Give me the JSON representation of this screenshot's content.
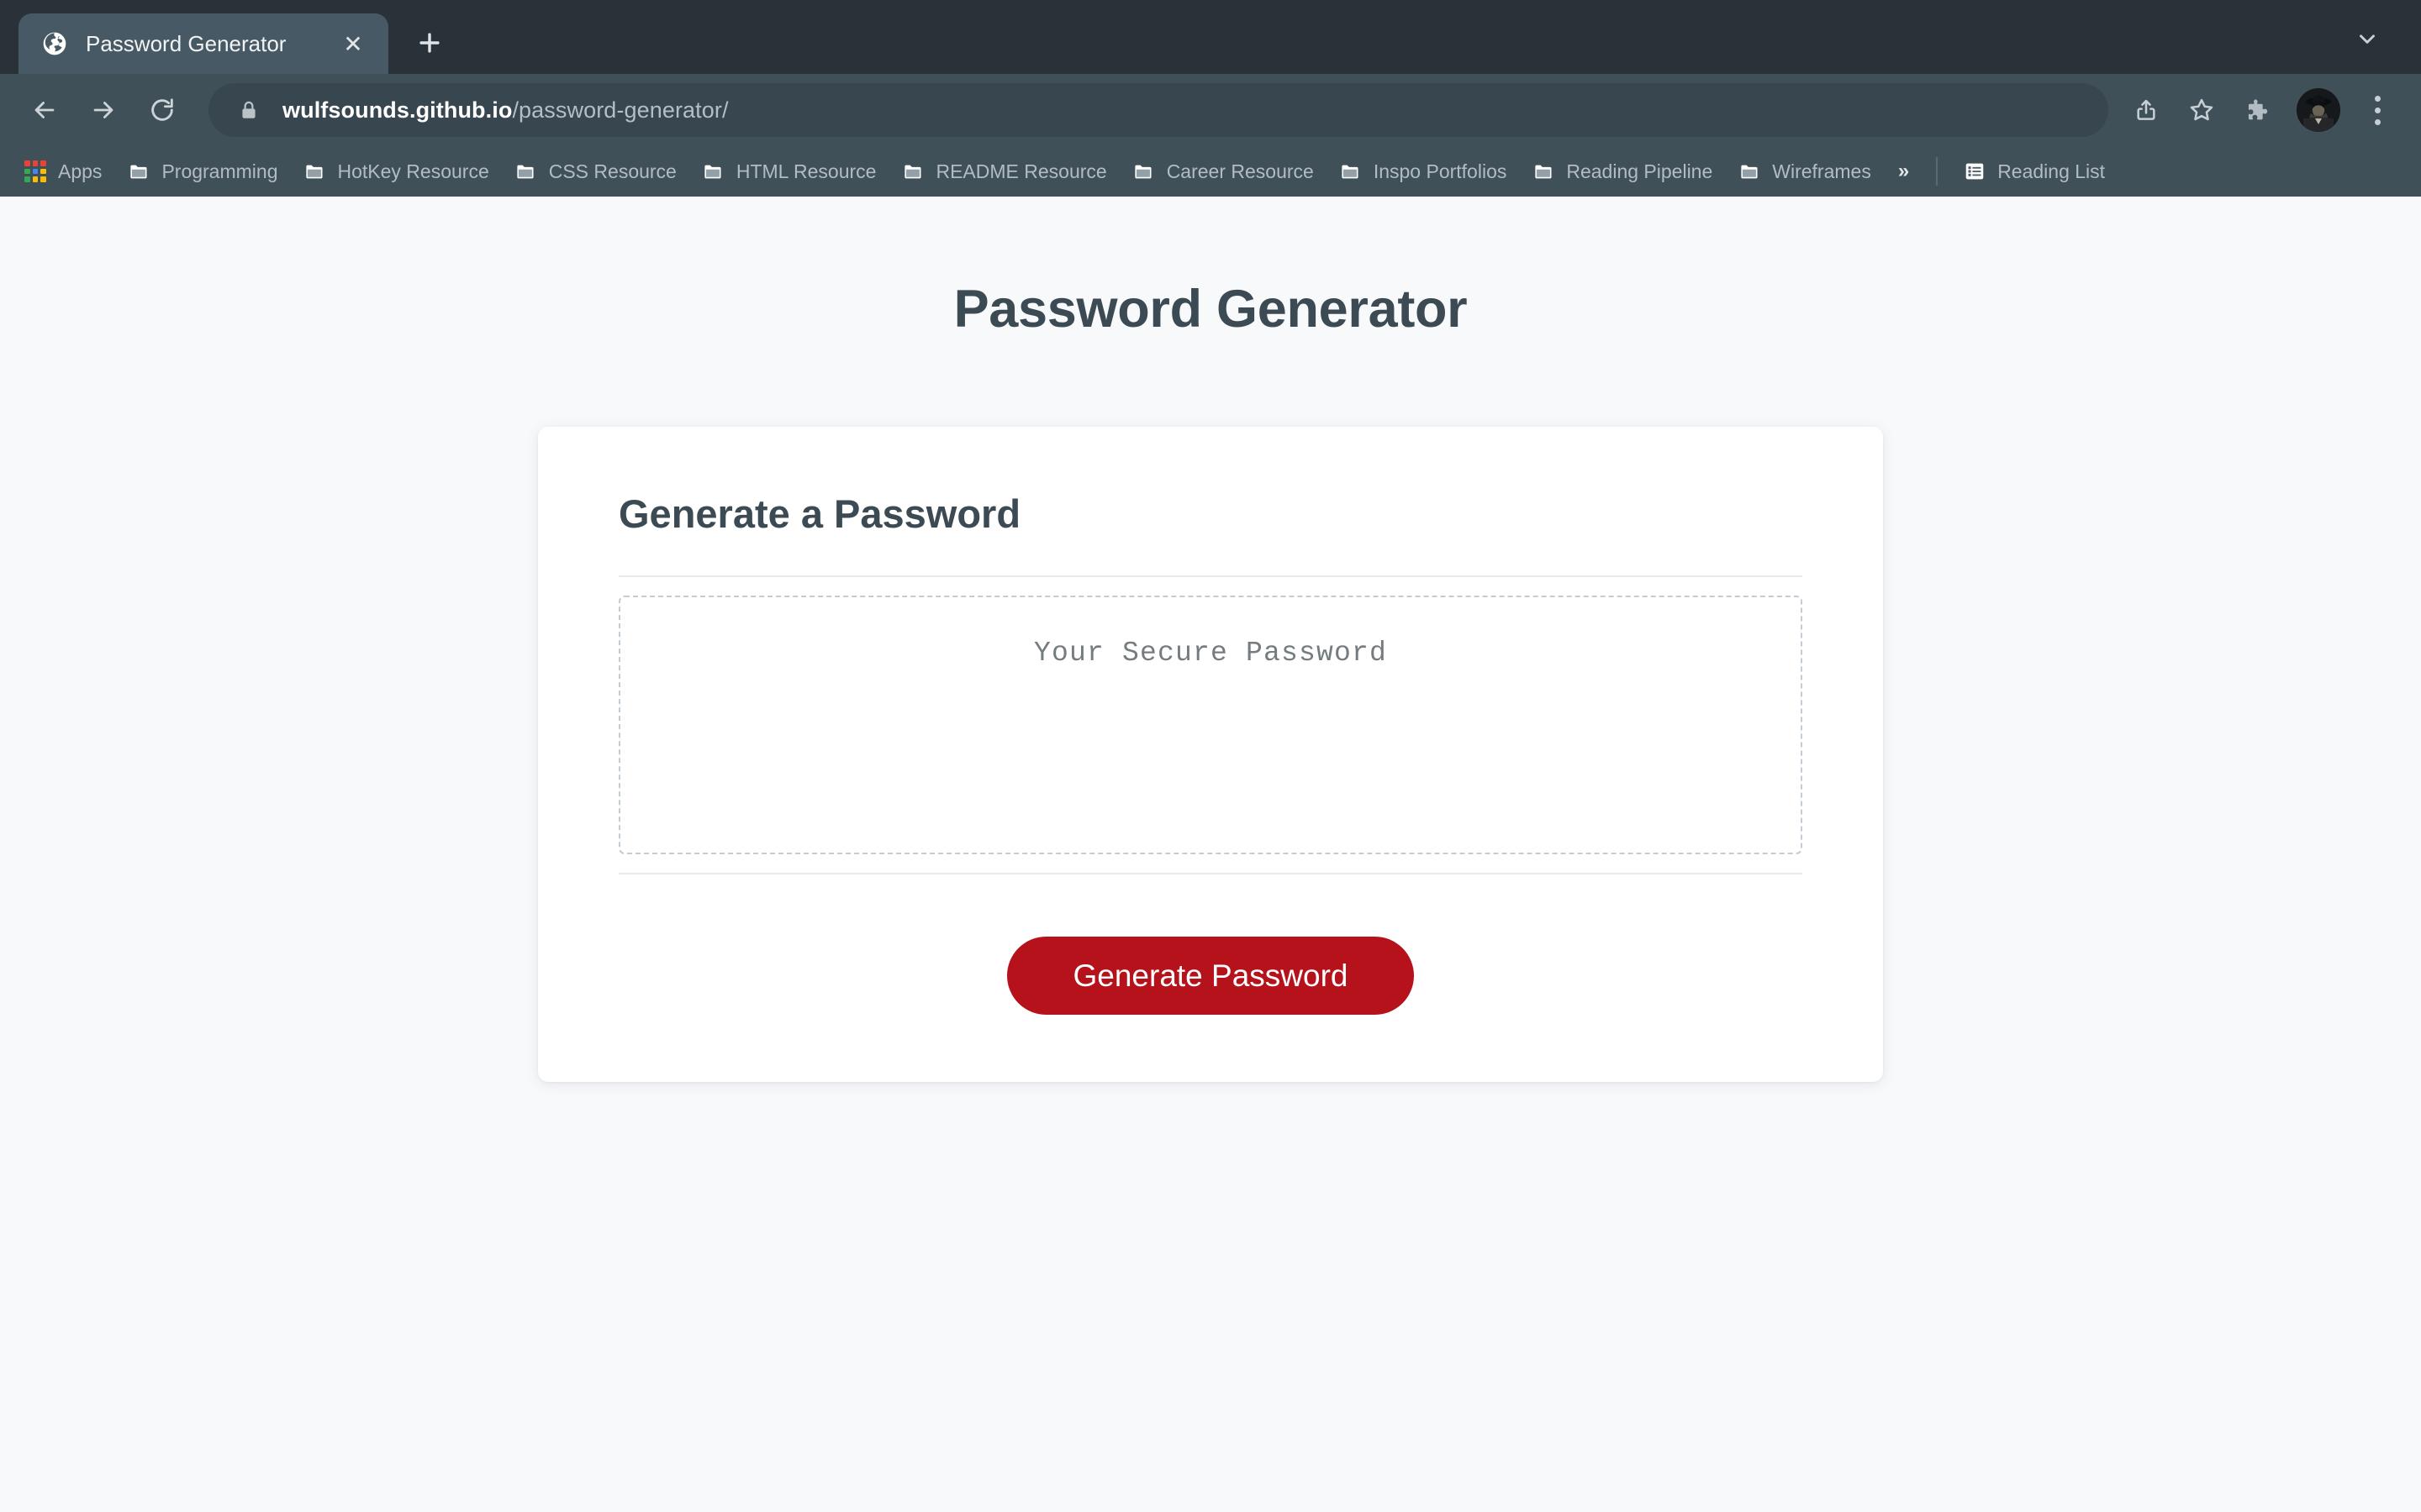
{
  "browser": {
    "tab": {
      "title": "Password Generator",
      "favicon": "globe-icon",
      "close_label": "✕"
    },
    "new_tab_label": "+",
    "tab_search_icon": "chevron-down-icon",
    "toolbar": {
      "back_icon": "back-arrow-icon",
      "forward_icon": "forward-arrow-icon",
      "reload_icon": "reload-icon",
      "lock_icon": "lock-icon",
      "url_host": "wulfsounds.github.io",
      "url_path": "/password-generator/",
      "share_icon": "share-icon",
      "bookmark_icon": "star-icon",
      "extensions_icon": "puzzle-piece-icon",
      "profile_icon": "avatar",
      "menu_icon": "three-dot-menu-icon"
    },
    "bookmarks": {
      "items": [
        {
          "label": "Apps",
          "icon": "apps-grid-icon"
        },
        {
          "label": "Programming",
          "icon": "folder-icon"
        },
        {
          "label": "HotKey Resource",
          "icon": "folder-icon"
        },
        {
          "label": "CSS Resource",
          "icon": "folder-icon"
        },
        {
          "label": "HTML Resource",
          "icon": "folder-icon"
        },
        {
          "label": "README Resource",
          "icon": "folder-icon"
        },
        {
          "label": "Career Resource",
          "icon": "folder-icon"
        },
        {
          "label": "Inspo Portfolios",
          "icon": "folder-icon"
        },
        {
          "label": "Reading Pipeline",
          "icon": "folder-icon"
        },
        {
          "label": "Wireframes",
          "icon": "folder-icon"
        }
      ],
      "overflow_label": "»",
      "reading_list": {
        "label": "Reading List",
        "icon": "reading-list-icon"
      }
    },
    "colors": {
      "tabstrip_bg": "#293238",
      "toolbar_bg": "#3f5059",
      "active_tab_bg": "#475964",
      "omnibox_bg": "#37464f"
    }
  },
  "page": {
    "title": "Password Generator",
    "card": {
      "heading": "Generate a Password",
      "password_placeholder": "Your Secure Password",
      "generate_button": "Generate Password"
    },
    "colors": {
      "background": "#f8f9fb",
      "heading": "#3c4a54",
      "accent_button": "#b5121b",
      "card": "#ffffff",
      "dashed_border": "#c3cbd3"
    }
  }
}
